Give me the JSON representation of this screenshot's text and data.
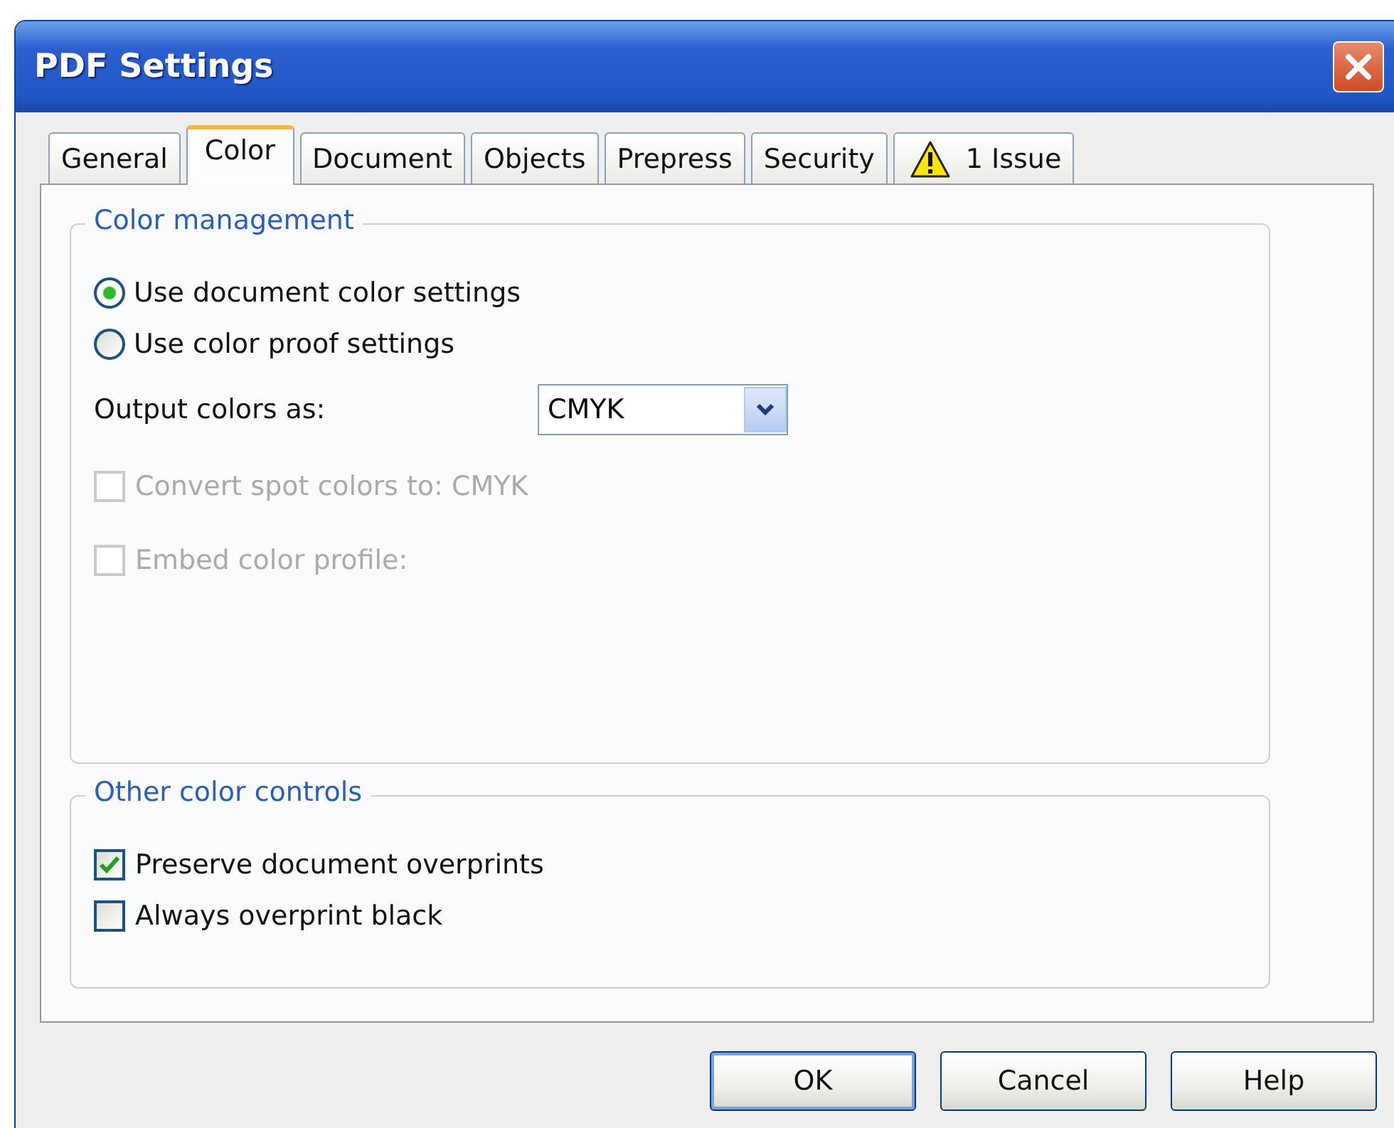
{
  "window": {
    "title": "PDF Settings"
  },
  "tabs": [
    {
      "label": "General",
      "selected": false,
      "kind": "plain"
    },
    {
      "label": "Color",
      "selected": true,
      "kind": "plain"
    },
    {
      "label": "Document",
      "selected": false,
      "kind": "plain"
    },
    {
      "label": "Objects",
      "selected": false,
      "kind": "plain"
    },
    {
      "label": "Prepress",
      "selected": false,
      "kind": "plain"
    },
    {
      "label": "Security",
      "selected": false,
      "kind": "plain"
    },
    {
      "label": "1 Issue",
      "selected": false,
      "kind": "warning"
    }
  ],
  "groups": [
    {
      "title": "Color management",
      "controls": [
        {
          "kind": "radio",
          "label": "Use document color settings",
          "selected": true,
          "disabled": false
        },
        {
          "kind": "radio",
          "label": "Use color proof settings",
          "selected": false,
          "disabled": false
        },
        {
          "kind": "dropdown",
          "label": "Output colors as:",
          "value": "CMYK"
        },
        {
          "kind": "checkbox",
          "label": "Convert spot colors to:  CMYK",
          "checked": false,
          "disabled": true
        },
        {
          "kind": "checkbox",
          "label": "Embed color profile:",
          "checked": false,
          "disabled": true
        }
      ]
    },
    {
      "title": "Other color controls",
      "controls": [
        {
          "kind": "checkbox",
          "label": "Preserve document overprints",
          "checked": true,
          "disabled": false
        },
        {
          "kind": "checkbox",
          "label": "Always overprint black",
          "checked": false,
          "disabled": false
        }
      ]
    }
  ],
  "buttons": [
    {
      "label": "OK",
      "default": true
    },
    {
      "label": "Cancel",
      "default": false
    },
    {
      "label": "Help",
      "default": false
    }
  ]
}
